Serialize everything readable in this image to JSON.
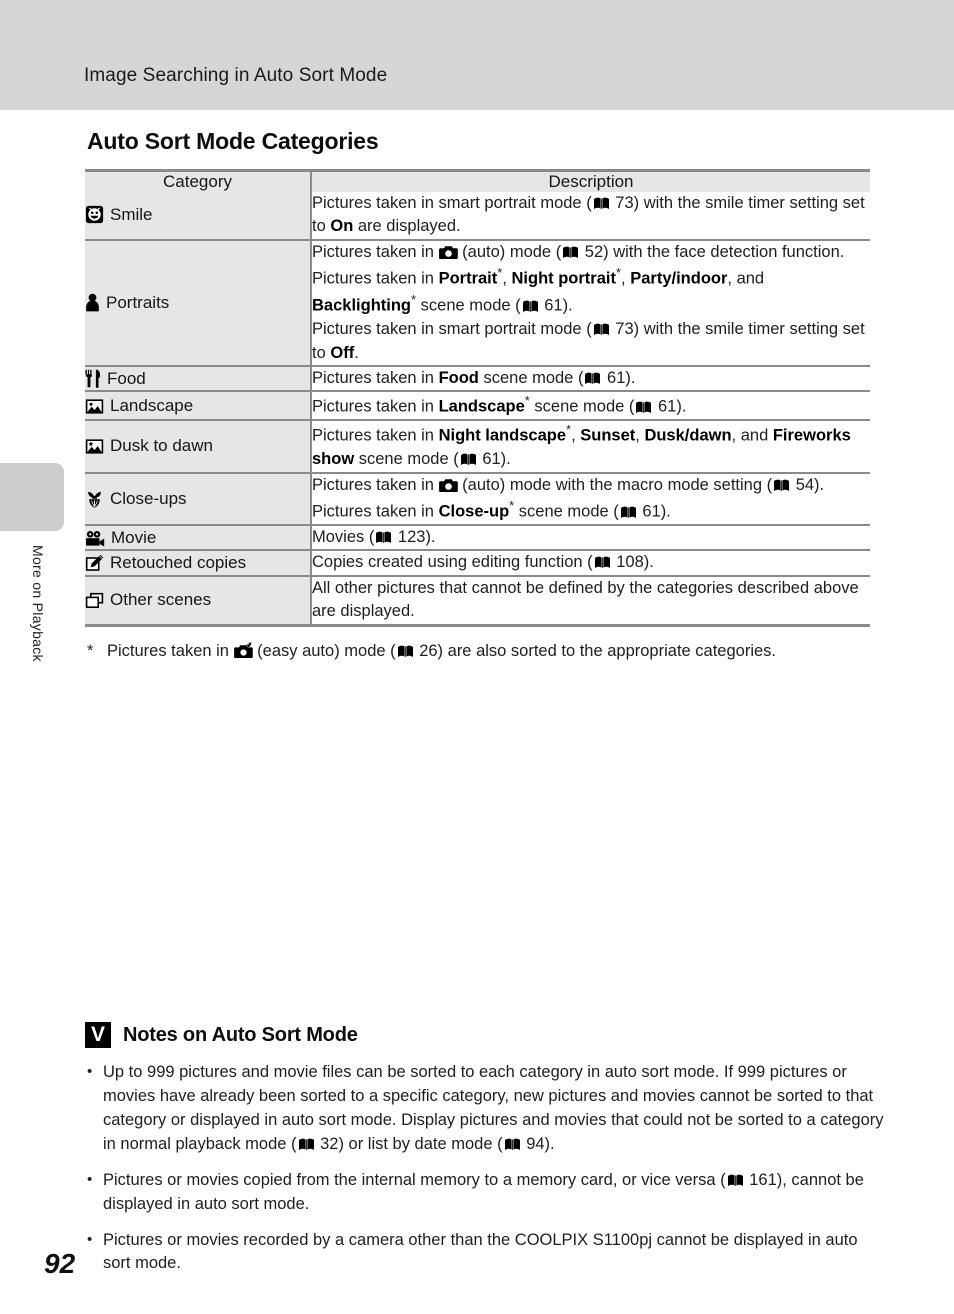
{
  "header": {
    "title": "Image Searching in Auto Sort Mode"
  },
  "sidebar": {
    "tab_label": "More on Playback"
  },
  "page_number": "92",
  "section": {
    "title": "Auto Sort Mode Categories"
  },
  "table": {
    "columns": [
      "Category",
      "Description"
    ],
    "rows": [
      {
        "icon": "smile-face-icon",
        "category": "Smile",
        "description_segments": [
          [
            {
              "t": "Pictures taken in smart portrait mode ("
            },
            {
              "t": "book-icon",
              "k": "book"
            },
            {
              "t": " 73) with the smile timer setting set to "
            },
            {
              "t": "On",
              "k": "b"
            },
            {
              "t": " are displayed."
            }
          ]
        ]
      },
      {
        "icon": "person-icon",
        "category": "Portraits",
        "description_segments": [
          [
            {
              "t": "Pictures taken in "
            },
            {
              "t": "camera-icon",
              "k": "camera"
            },
            {
              "t": " (auto) mode ("
            },
            {
              "t": "book-icon",
              "k": "book"
            },
            {
              "t": " 52) with the face detection function. Pictures taken in "
            },
            {
              "t": "Portrait",
              "k": "b"
            },
            {
              "t": "*",
              "k": "star"
            },
            {
              "t": ", "
            },
            {
              "t": "Night portrait",
              "k": "b"
            },
            {
              "t": "*",
              "k": "star"
            },
            {
              "t": ", "
            },
            {
              "t": "Party/indoor",
              "k": "b"
            },
            {
              "t": ", and "
            },
            {
              "t": "Backlighting",
              "k": "b"
            },
            {
              "t": "*",
              "k": "star"
            },
            {
              "t": " scene mode ("
            },
            {
              "t": "book-icon",
              "k": "book"
            },
            {
              "t": " 61)."
            }
          ],
          [
            {
              "t": "Pictures taken in smart portrait mode ("
            },
            {
              "t": "book-icon",
              "k": "book"
            },
            {
              "t": " 73) with the smile timer setting set to "
            },
            {
              "t": "Off",
              "k": "b"
            },
            {
              "t": "."
            }
          ]
        ]
      },
      {
        "icon": "fork-knife-icon",
        "category": "Food",
        "description_segments": [
          [
            {
              "t": "Pictures taken in "
            },
            {
              "t": "Food",
              "k": "b"
            },
            {
              "t": " scene mode ("
            },
            {
              "t": "book-icon",
              "k": "book"
            },
            {
              "t": " 61)."
            }
          ]
        ]
      },
      {
        "icon": "landscape-icon",
        "category": "Landscape",
        "description_segments": [
          [
            {
              "t": "Pictures taken in "
            },
            {
              "t": "Landscape",
              "k": "b"
            },
            {
              "t": "*",
              "k": "star"
            },
            {
              "t": " scene mode ("
            },
            {
              "t": "book-icon",
              "k": "book"
            },
            {
              "t": " 61)."
            }
          ]
        ]
      },
      {
        "icon": "dusk-dawn-icon",
        "category": "Dusk to dawn",
        "description_segments": [
          [
            {
              "t": "Pictures taken in "
            },
            {
              "t": "Night landscape",
              "k": "b"
            },
            {
              "t": "*",
              "k": "star"
            },
            {
              "t": ", "
            },
            {
              "t": "Sunset",
              "k": "b"
            },
            {
              "t": ", "
            },
            {
              "t": "Dusk/dawn",
              "k": "b"
            },
            {
              "t": ", and "
            },
            {
              "t": "Fireworks show",
              "k": "b"
            },
            {
              "t": " scene mode ("
            },
            {
              "t": "book-icon",
              "k": "book"
            },
            {
              "t": " 61)."
            }
          ]
        ]
      },
      {
        "icon": "flower-icon",
        "category": "Close-ups",
        "description_segments": [
          [
            {
              "t": "Pictures taken in "
            },
            {
              "t": "camera-icon",
              "k": "camera"
            },
            {
              "t": " (auto) mode with the macro mode setting ("
            },
            {
              "t": "book-icon",
              "k": "book"
            },
            {
              "t": " 54)."
            }
          ],
          [
            {
              "t": "Pictures taken in "
            },
            {
              "t": "Close-up",
              "k": "b"
            },
            {
              "t": "*",
              "k": "star"
            },
            {
              "t": " scene mode ("
            },
            {
              "t": "book-icon",
              "k": "book"
            },
            {
              "t": " 61)."
            }
          ]
        ]
      },
      {
        "icon": "movie-camera-icon",
        "category": "Movie",
        "description_segments": [
          [
            {
              "t": "Movies ("
            },
            {
              "t": "book-icon",
              "k": "book"
            },
            {
              "t": " 123)."
            }
          ]
        ]
      },
      {
        "icon": "retouch-pen-icon",
        "category": "Retouched copies",
        "description_segments": [
          [
            {
              "t": "Copies created using editing function ("
            },
            {
              "t": "book-icon",
              "k": "book"
            },
            {
              "t": " 108)."
            }
          ]
        ]
      },
      {
        "icon": "stacked-frames-icon",
        "category": "Other scenes",
        "description_segments": [
          [
            {
              "t": "All other pictures that cannot be defined by the categories described above are displayed."
            }
          ]
        ]
      }
    ]
  },
  "footnote": {
    "mark": "*",
    "segments": [
      {
        "t": "Pictures taken in "
      },
      {
        "t": "easy-auto-icon",
        "k": "easyauto"
      },
      {
        "t": " (easy auto) mode ("
      },
      {
        "t": "book-icon",
        "k": "book"
      },
      {
        "t": " 26) are also sorted to the appropriate categories."
      }
    ]
  },
  "notes": {
    "badge": "V",
    "title": "Notes on Auto Sort Mode",
    "items": [
      [
        {
          "t": "Up to 999 pictures and movie files can be sorted to each category in auto sort mode. If 999 pictures or movies have already been sorted to a specific category, new pictures and movies cannot be sorted to that category or displayed in auto sort mode. Display pictures and movies that could not be sorted to a category in normal playback mode ("
        },
        {
          "t": "book-icon",
          "k": "book"
        },
        {
          "t": " 32) or list by date mode ("
        },
        {
          "t": "book-icon",
          "k": "book"
        },
        {
          "t": " 94)."
        }
      ],
      [
        {
          "t": "Pictures or movies copied from the internal memory to a memory card, or vice versa ("
        },
        {
          "t": "book-icon",
          "k": "book"
        },
        {
          "t": " 161), cannot be displayed in auto sort mode."
        }
      ],
      [
        {
          "t": "Pictures or movies recorded by a camera other than the COOLPIX S1100pj cannot be displayed in auto sort mode."
        }
      ]
    ]
  },
  "colors": {
    "header_band": "#d6d6d6",
    "table_cat_bg": "#e6e6e6",
    "table_border": "#8a8a8a",
    "sidebar_tab": "#cccccc"
  }
}
